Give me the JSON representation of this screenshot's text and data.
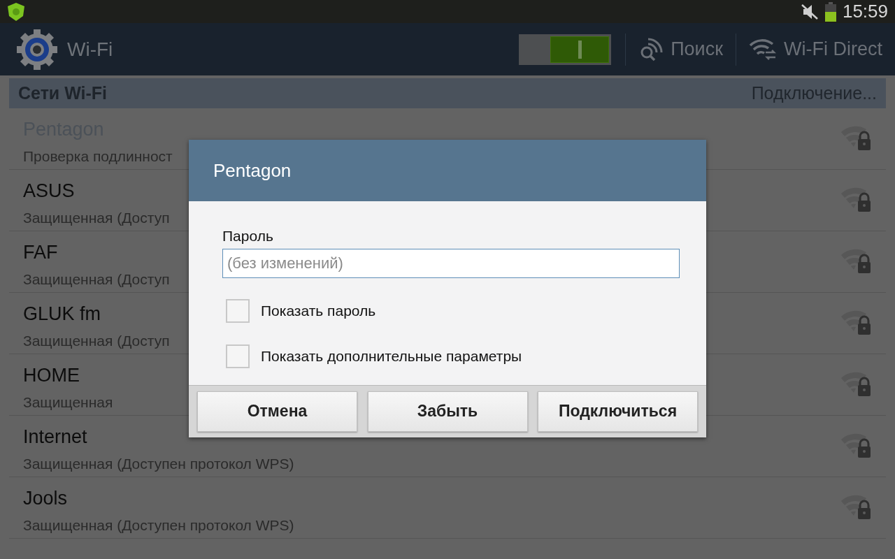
{
  "status_bar": {
    "time": "15:59"
  },
  "action_bar": {
    "title": "Wi-Fi",
    "wifi_switch": {
      "on": true
    },
    "actions": [
      {
        "kind": "search",
        "label": "Поиск"
      },
      {
        "kind": "direct",
        "label": "Wi-Fi Direct"
      }
    ]
  },
  "section": {
    "title": "Сети Wi-Fi",
    "status": "Подключение..."
  },
  "networks": [
    {
      "name": "Pentagon",
      "status": "Проверка подлинност",
      "connecting": true
    },
    {
      "name": "ASUS",
      "status": "Защищенная (Доступ",
      "connecting": false
    },
    {
      "name": "FAF",
      "status": "Защищенная (Доступ",
      "connecting": false
    },
    {
      "name": "GLUK fm",
      "status": "Защищенная (Доступ",
      "connecting": false
    },
    {
      "name": "HOME",
      "status": "Защищенная",
      "connecting": false
    },
    {
      "name": "Internet",
      "status": "Защищенная (Доступен протокол WPS)",
      "connecting": false
    },
    {
      "name": "Jools",
      "status": "Защищенная (Доступен протокол WPS)",
      "connecting": false
    }
  ],
  "dialog": {
    "title": "Pentagon",
    "field_label": "Пароль",
    "password": {
      "placeholder": "(без изменений)"
    },
    "options": [
      {
        "label": "Показать пароль",
        "checked": false
      },
      {
        "label": "Показать дополнительные параметры",
        "checked": false
      }
    ],
    "buttons": [
      "Отмена",
      "Забыть",
      "Подключиться"
    ]
  }
}
